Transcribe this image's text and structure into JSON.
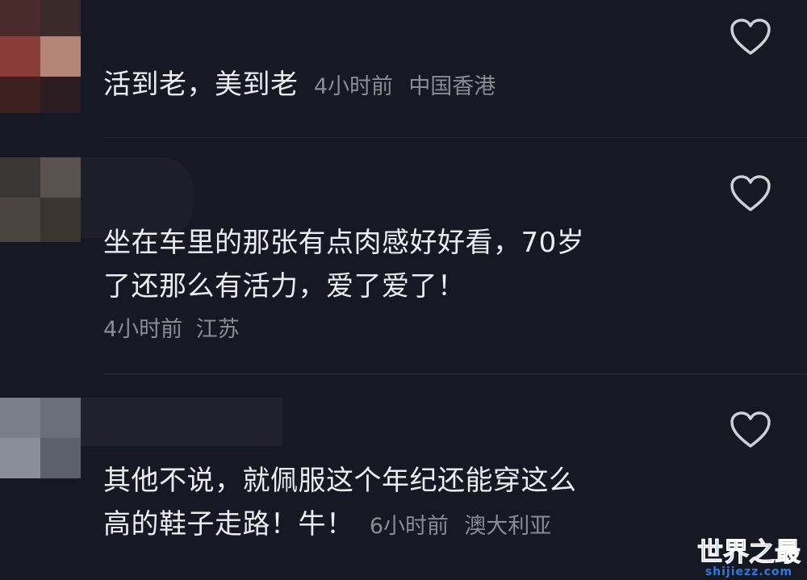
{
  "comments": [
    {
      "text": "活到老，美到老",
      "time": "4小时前",
      "location": "中国香港"
    },
    {
      "text_line1": "坐在车里的那张有点肉感好好看，70岁",
      "text_line2": "了还那么有活力，爱了爱了！",
      "time": "4小时前",
      "location": "江苏"
    },
    {
      "text_line1": "其他不说，就佩服这个年纪还能穿这么",
      "text_line2": "高的鞋子走路！牛！",
      "time": "6小时前",
      "location": "澳大利亚"
    }
  ],
  "watermark": {
    "title": "世界之最",
    "url": "shijiezz.com"
  },
  "icons": {
    "like": "heart-outline-icon"
  }
}
